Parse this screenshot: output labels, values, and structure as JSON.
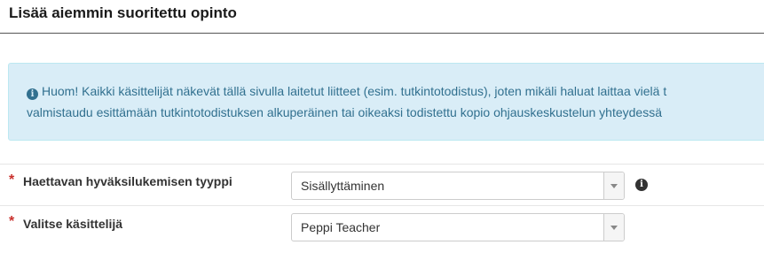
{
  "header": {
    "title": "Lisää aiemmin suoritettu opinto"
  },
  "notice": {
    "icon": "info-circle-icon",
    "line1": "Huom! Kaikki käsittelijät näkevät tällä sivulla laitetut liitteet (esim. tutkintotodistus), joten mikäli haluat laittaa vielä t",
    "line2": "valmistaudu esittämään tutkintotodistuksen alkuperäinen tai oikeaksi todistettu kopio ohjauskeskustelun yhteydessä"
  },
  "form": {
    "required_marker": "*",
    "recognition_type": {
      "label": "Haettavan hyväksilukemisen tyyppi",
      "selected": "Sisällyttäminen",
      "help_icon": "info-circle-icon"
    },
    "handler": {
      "label": "Valitse käsittelijä",
      "selected": "Peppi Teacher"
    }
  },
  "colors": {
    "alert_bg": "#d9edf7",
    "alert_text": "#31708f",
    "required": "#c9302c"
  }
}
